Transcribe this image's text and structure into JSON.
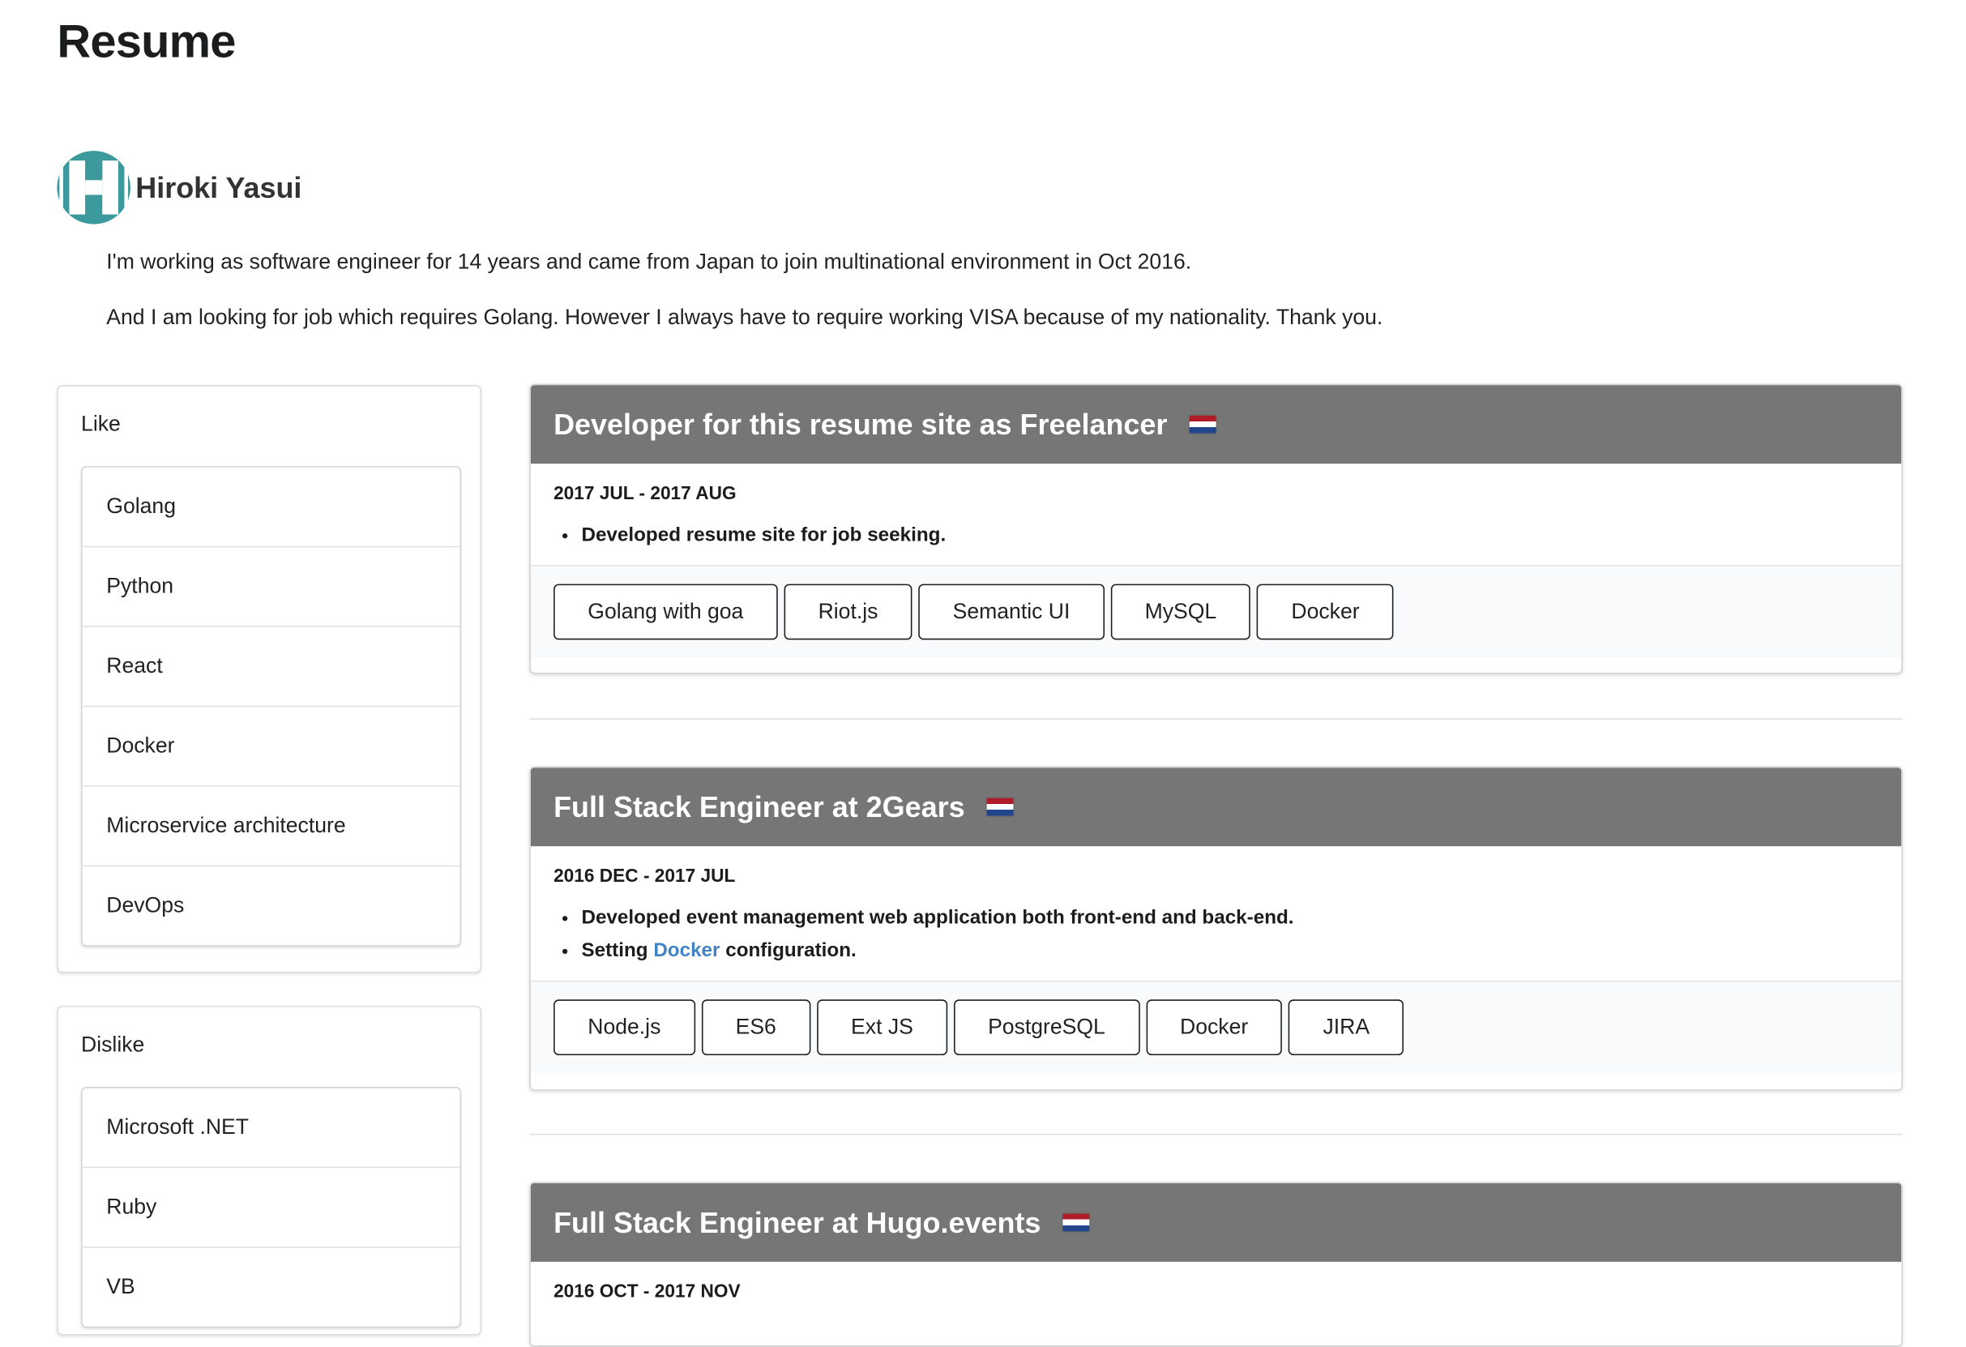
{
  "page": {
    "title": "Resume"
  },
  "profile": {
    "name": "Hiroki Yasui",
    "intro": [
      "I'm working as software engineer for 14 years and came from Japan to join multinational environment in Oct 2016.",
      "And I am looking for job which requires Golang. However I always have to require working VISA because of my nationality. Thank you."
    ],
    "avatar_color": "#3d9a9c"
  },
  "like": {
    "title": "Like",
    "items": [
      "Golang",
      "Python",
      "React",
      "Docker",
      "Microservice architecture",
      "DevOps"
    ]
  },
  "dislike": {
    "title": "Dislike",
    "items": [
      "Microsoft .NET",
      "Ruby",
      "VB"
    ]
  },
  "jobs": [
    {
      "title": "Developer for this resume site as Freelancer",
      "flag": "netherlands-flag",
      "period": "2017 JUL - 2017 AUG",
      "points": [
        "Developed resume site for job seeking."
      ],
      "tags": [
        "Golang with goa",
        "Riot.js",
        "Semantic UI",
        "MySQL",
        "Docker"
      ]
    },
    {
      "title": "Full Stack Engineer at 2Gears",
      "flag": "netherlands-flag",
      "period": "2016 DEC - 2017 JUL",
      "points": [
        "Developed event management web application both front-end and back-end."
      ],
      "point2": {
        "prefix": "Setting",
        "link": "Docker",
        "suffix": "configuration."
      },
      "tags": [
        "Node.js",
        "ES6",
        "Ext JS",
        "PostgreSQL",
        "Docker",
        "JIRA"
      ]
    },
    {
      "title": "Full Stack Engineer at Hugo.events",
      "flag": "netherlands-flag",
      "period": "2016 OCT - 2017 NOV"
    }
  ],
  "colors": {
    "header_gray": "#767676",
    "link_blue": "#4183c4"
  }
}
